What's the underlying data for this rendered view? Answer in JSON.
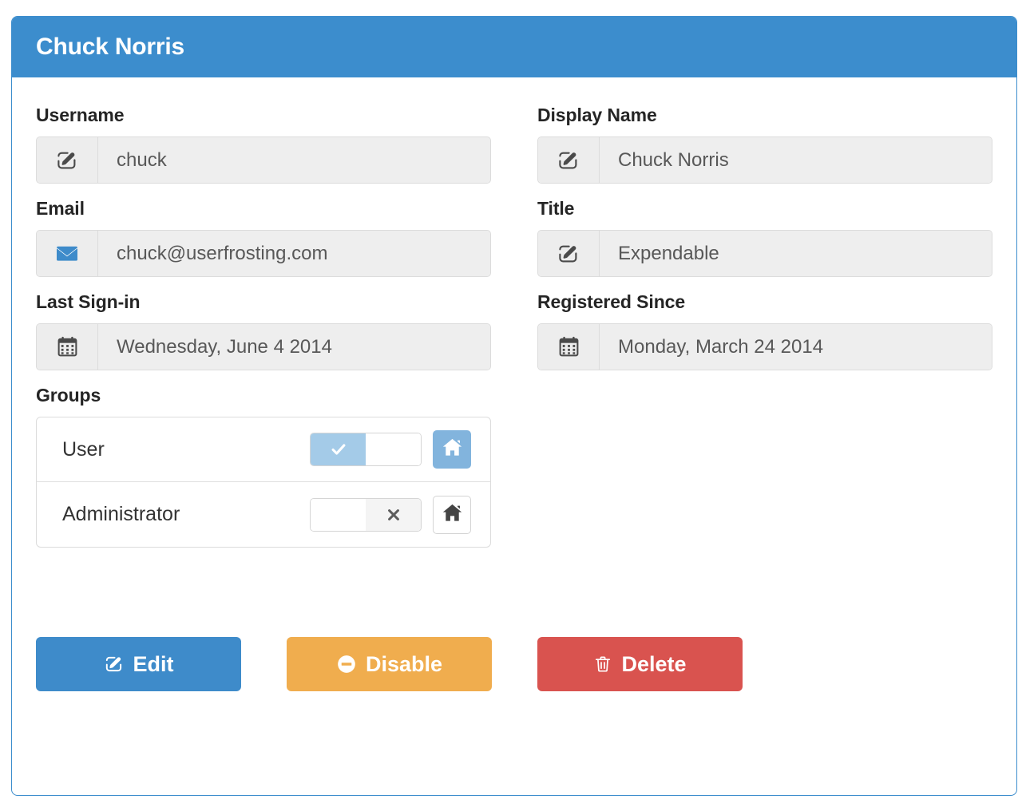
{
  "panel": {
    "title": "Chuck Norris",
    "header_color": "#3c8dcd",
    "border_color": "#3c8dcd"
  },
  "fields": {
    "username": {
      "label": "Username",
      "value": "chuck",
      "icon": "pencil-square-icon"
    },
    "display_name": {
      "label": "Display Name",
      "value": "Chuck Norris",
      "icon": "pencil-square-icon"
    },
    "email": {
      "label": "Email",
      "value": "chuck@userfrosting.com",
      "icon": "envelope-icon"
    },
    "title": {
      "label": "Title",
      "value": "Expendable",
      "icon": "pencil-square-icon"
    },
    "last_signin": {
      "label": "Last Sign-in",
      "value": "Wednesday, June 4 2014",
      "icon": "calendar-icon"
    },
    "registered_since": {
      "label": "Registered Since",
      "value": "Monday, March 24 2014",
      "icon": "calendar-icon"
    }
  },
  "groups": {
    "label": "Groups",
    "items": [
      {
        "name": "User",
        "enabled": true,
        "toggle_glyph": "check-icon",
        "primary_group": true,
        "home_icon": "home-icon"
      },
      {
        "name": "Administrator",
        "enabled": false,
        "toggle_glyph": "times-icon",
        "primary_group": false,
        "home_icon": "home-icon"
      }
    ]
  },
  "actions": {
    "edit": {
      "label": "Edit",
      "icon": "pencil-square-icon",
      "color": "#3e8bca"
    },
    "disable": {
      "label": "Disable",
      "icon": "minus-circle-icon",
      "color": "#f0ad4e"
    },
    "delete": {
      "label": "Delete",
      "icon": "trash-icon",
      "color": "#d9534f"
    }
  }
}
